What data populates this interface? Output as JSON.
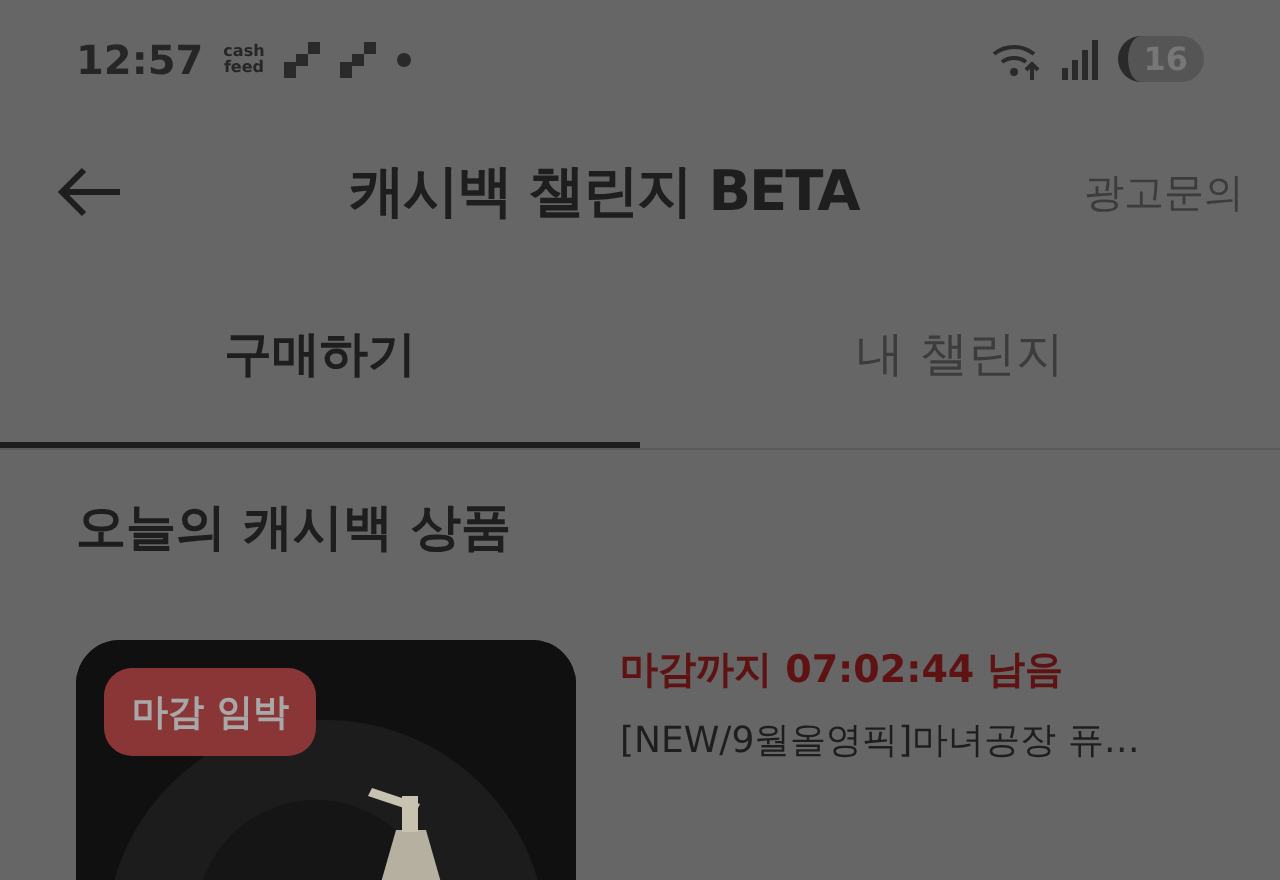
{
  "status_bar": {
    "time": "12:57",
    "app_badge": "cash\nfeed",
    "battery": "16"
  },
  "header": {
    "title": "캐시백 챌린지 BETA",
    "action": "광고문의"
  },
  "tabs": [
    {
      "label": "구매하기",
      "selected": true
    },
    {
      "label": "내 챌린지",
      "selected": false
    }
  ],
  "section": {
    "title": "오늘의 캐시백 상품"
  },
  "products": [
    {
      "badge": "마감 임박",
      "deadline": "마감까지 07:02:44 남음",
      "name": "[NEW/9월올영픽]마녀공장 퓨…"
    }
  ]
}
